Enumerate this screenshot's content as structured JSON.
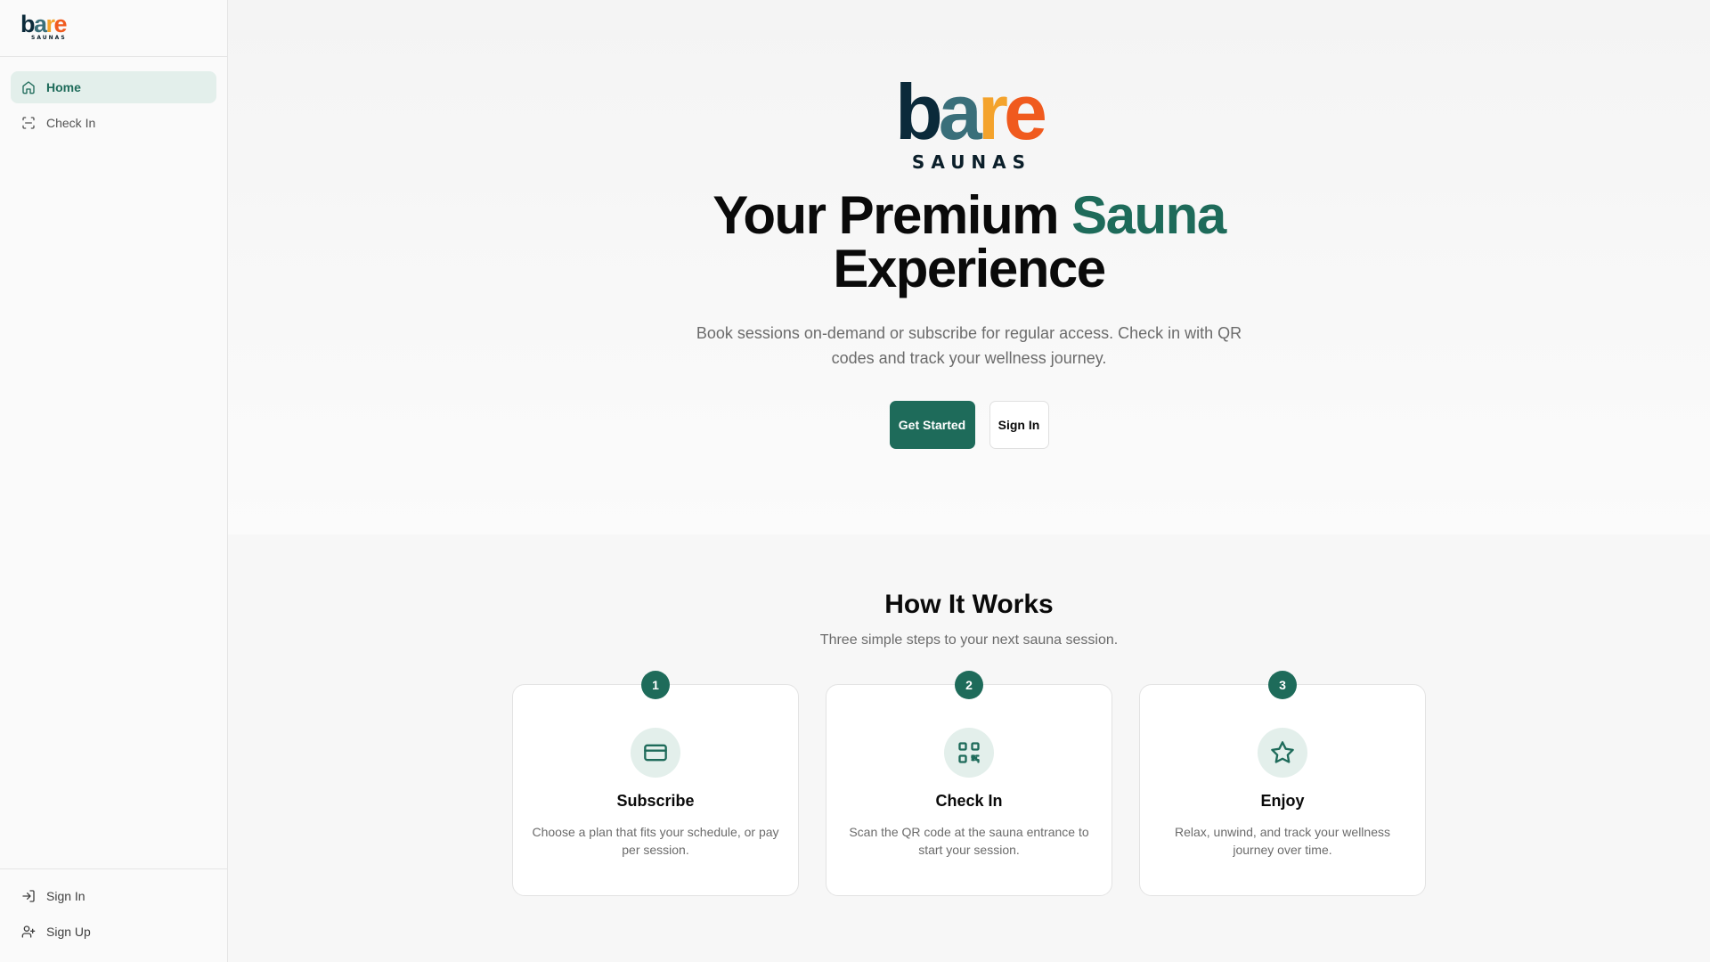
{
  "brand": {
    "letters": [
      "b",
      "a",
      "r",
      "e"
    ],
    "sub": "SAUNAS",
    "colors": {
      "b": "#0b2a3a",
      "a": "#3a6f7a",
      "r": "#f4a32c",
      "e": "#f05a1e"
    }
  },
  "sidebar": {
    "items": [
      {
        "label": "Home",
        "icon": "home-icon",
        "active": true
      },
      {
        "label": "Check In",
        "icon": "scan-icon",
        "active": false
      }
    ],
    "footer": [
      {
        "label": "Sign In",
        "icon": "sign-in-icon"
      },
      {
        "label": "Sign Up",
        "icon": "user-plus-icon"
      }
    ]
  },
  "hero": {
    "title_part1": "Your Premium ",
    "title_accent": "Sauna",
    "title_part2": "Experience",
    "description": "Book sessions on-demand or subscribe for regular access. Check in with QR codes and track your wellness journey.",
    "primary_button": "Get Started",
    "secondary_button": "Sign In"
  },
  "how": {
    "title": "How It Works",
    "subtitle": "Three simple steps to your next sauna session.",
    "steps": [
      {
        "number": "1",
        "title": "Subscribe",
        "description": "Choose a plan that fits your schedule, or pay per session.",
        "icon": "credit-card-icon"
      },
      {
        "number": "2",
        "title": "Check In",
        "description": "Scan the QR code at the sauna entrance to start your session.",
        "icon": "qr-code-icon"
      },
      {
        "number": "3",
        "title": "Enjoy",
        "description": "Relax, unwind, and track your wellness journey over time.",
        "icon": "star-icon"
      }
    ]
  },
  "colors": {
    "accent": "#1e6b5a",
    "accent_soft": "#e3efeb"
  }
}
